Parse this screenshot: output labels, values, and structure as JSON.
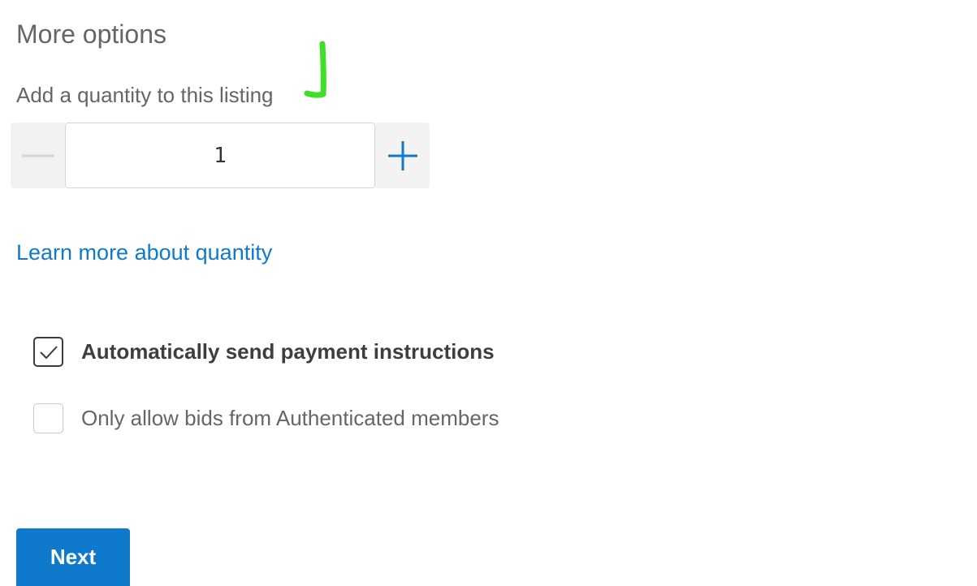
{
  "section": {
    "title": "More options"
  },
  "quantity": {
    "label": "Add a quantity to this listing",
    "value": "1",
    "decrement_icon": "minus-icon",
    "increment_icon": "plus-icon"
  },
  "learn_more": {
    "text": "Learn more about quantity"
  },
  "options": [
    {
      "label": "Automatically send payment instructions",
      "checked": true
    },
    {
      "label": "Only allow bids from Authenticated members",
      "checked": false
    }
  ],
  "next_button": {
    "label": "Next"
  },
  "colors": {
    "accent": "#0f7acb",
    "annotation": "#3de024",
    "text": "#65656a",
    "stepper_bg": "#f2f2f2"
  }
}
